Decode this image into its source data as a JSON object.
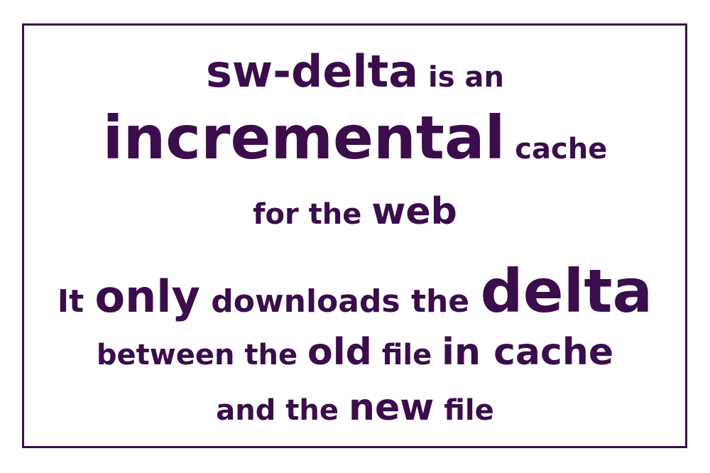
{
  "colors": {
    "text": "#3b0d4c",
    "border": "#3b0d4c",
    "background": "#ffffff"
  },
  "lines": [
    {
      "parts": [
        "sw-delta",
        " is an"
      ]
    },
    {
      "parts": [
        "incremental",
        " cache"
      ]
    },
    {
      "parts": [
        "for the ",
        "web"
      ]
    },
    {
      "parts": [
        "It ",
        "only",
        " downloads the ",
        "delta"
      ]
    },
    {
      "parts": [
        "between the ",
        "old",
        " file ",
        "in cache"
      ]
    },
    {
      "parts": [
        "and the ",
        "new",
        " file"
      ]
    }
  ]
}
